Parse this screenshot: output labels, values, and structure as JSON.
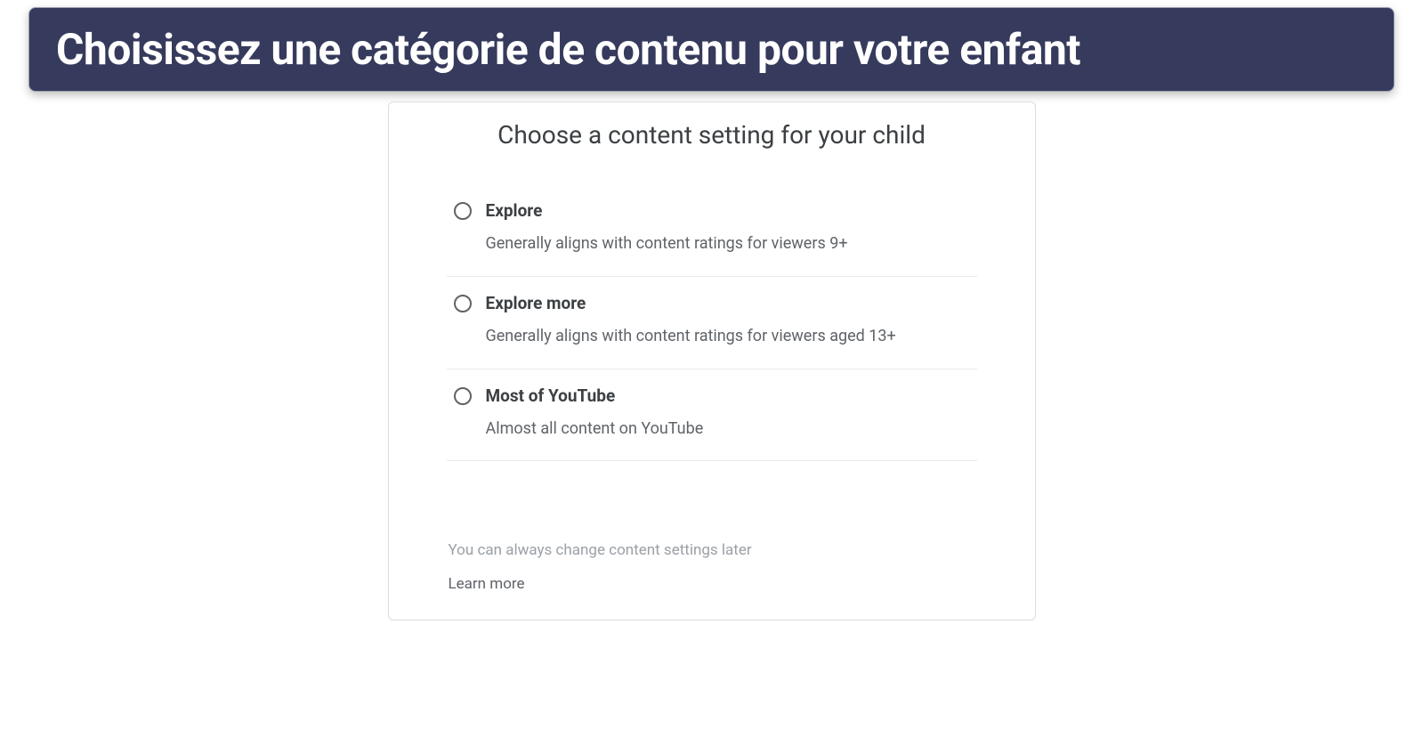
{
  "banner": {
    "title": "Choisissez une catégorie de contenu pour votre enfant"
  },
  "card": {
    "title": "Choose a content setting for your child",
    "options": [
      {
        "label": "Explore",
        "description": "Generally aligns with content ratings for viewers 9+"
      },
      {
        "label": "Explore more",
        "description": "Generally aligns with content ratings for viewers aged 13+"
      },
      {
        "label": "Most of YouTube",
        "description": "Almost all content on YouTube"
      }
    ],
    "footerText": "You can always change content settings later",
    "learnMore": "Learn more"
  }
}
